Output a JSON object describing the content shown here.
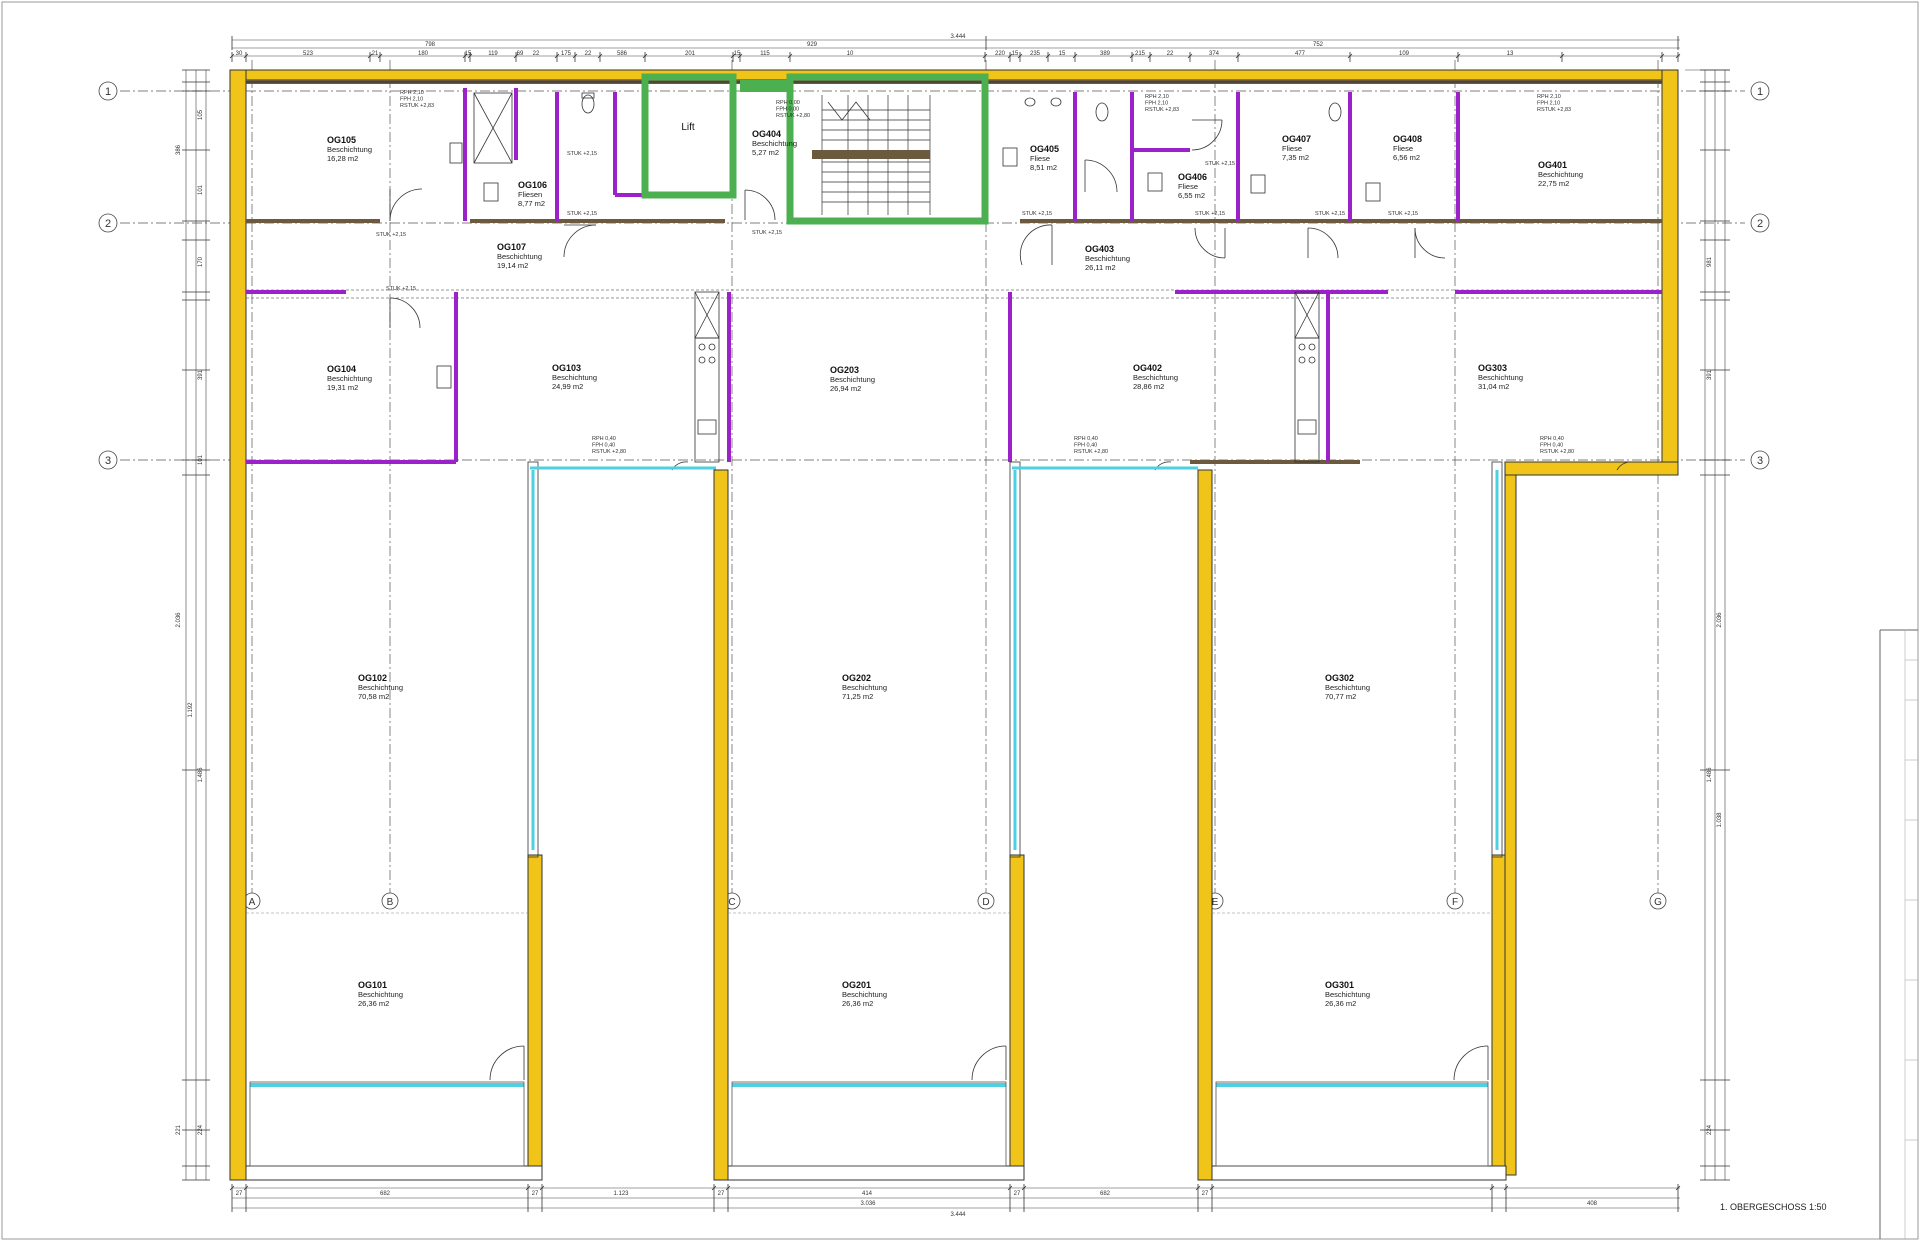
{
  "plan": {
    "title": "1. OBERGESCHOSS 1:50",
    "axes_rows": [
      "1",
      "2",
      "3"
    ],
    "axes_cols": [
      "A",
      "B",
      "C",
      "D",
      "E",
      "F",
      "G"
    ],
    "top_dims": {
      "overall": "3.444",
      "seg_a": "798",
      "seg_b": "929",
      "seg_c": "752",
      "details": [
        "30",
        "523",
        "21",
        "180",
        "15",
        "119",
        "69",
        "22",
        "175",
        "22",
        "586",
        "201",
        "15",
        "115",
        "10",
        "220",
        "15",
        "235",
        "15",
        "389",
        "215",
        "22",
        "374",
        "477",
        "109",
        "13"
      ]
    },
    "bottom_dims": {
      "overall": "3.444",
      "row1": [
        "27",
        "682",
        "27",
        "1.123",
        "27",
        "414",
        "27",
        "682",
        "27"
      ],
      "row2": [
        "3.036",
        "408"
      ]
    },
    "left_dims": [
      "386",
      "2.036",
      "1.192",
      "1.486",
      "224",
      "221",
      "105",
      "170",
      "391",
      "101",
      "101"
    ],
    "right_dims": [
      "2.036",
      "1.486",
      "1.038",
      "224",
      "981",
      "391"
    ],
    "rooms": [
      {
        "id": "OG105",
        "type": "Beschichtung",
        "area": "16,28 m2"
      },
      {
        "id": "OG106",
        "type": "Fliesen",
        "area": "8,77 m2"
      },
      {
        "id": "Lift",
        "type": "",
        "area": ""
      },
      {
        "id": "OG404",
        "type": "Beschichtung",
        "area": "5,27 m2"
      },
      {
        "id": "OG405",
        "type": "Fliese",
        "area": "8,51 m2"
      },
      {
        "id": "OG406",
        "type": "Fliese",
        "area": "6,55 m2"
      },
      {
        "id": "OG407",
        "type": "Fliese",
        "area": "7,35 m2"
      },
      {
        "id": "OG408",
        "type": "Fliese",
        "area": "6,56 m2"
      },
      {
        "id": "OG401",
        "type": "Beschichtung",
        "area": "22,75 m2"
      },
      {
        "id": "OG107",
        "type": "Beschichtung",
        "area": "19,14 m2"
      },
      {
        "id": "OG403",
        "type": "Beschichtung",
        "area": "26,11 m2"
      },
      {
        "id": "OG104",
        "type": "Beschichtung",
        "area": "19,31 m2"
      },
      {
        "id": "OG103",
        "type": "Beschichtung",
        "area": "24,99 m2"
      },
      {
        "id": "OG203",
        "type": "Beschichtung",
        "area": "26,94 m2"
      },
      {
        "id": "OG402",
        "type": "Beschichtung",
        "area": "28,86 m2"
      },
      {
        "id": "OG303",
        "type": "Beschichtung",
        "area": "31,04 m2"
      },
      {
        "id": "OG102",
        "type": "Beschichtung",
        "area": "70,58 m2"
      },
      {
        "id": "OG202",
        "type": "Beschichtung",
        "area": "71,25 m2"
      },
      {
        "id": "OG302",
        "type": "Beschichtung",
        "area": "70,77 m2"
      },
      {
        "id": "OG101",
        "type": "Beschichtung",
        "area": "26,36 m2"
      },
      {
        "id": "OG201",
        "type": "Beschichtung",
        "area": "26,36 m2"
      },
      {
        "id": "OG301",
        "type": "Beschichtung",
        "area": "26,36 m2"
      }
    ],
    "annotations": {
      "stuk": [
        "STUK +2,15",
        "STUK +2,15",
        "STUK +2,15",
        "STUK +2,15",
        "STUK +2,15",
        "STUK +2,15",
        "STUK +2,15",
        "STUK +2,15",
        "STUK +2,15",
        "STUK +2,15"
      ],
      "rph_a": [
        "RPH 2,10",
        "FPH 2,10",
        "RSTUK +2,83"
      ],
      "rph_b": [
        "RPH 0,00",
        "FPH 0,00",
        "RSTUK +2,80"
      ],
      "rph_c": [
        "RPH 2,10",
        "FPH 2,10",
        "RSTUK +2,83"
      ],
      "rph_d": [
        "RPH 2,10",
        "FPH 2,10",
        "RSTUK +2,83"
      ],
      "rph_e": [
        "RPH 0,40",
        "FPH 0,40",
        "RSTUK +2,80"
      ],
      "rph_f": [
        "RPH 0,40",
        "FPH 0,40",
        "RSTUK +2,80"
      ],
      "rph_g": [
        "RPH 0,40",
        "FPH 0,40",
        "RSTUK +2,80"
      ]
    },
    "colors": {
      "insulation": "#f0c419",
      "partition": "#9b22c9",
      "stair": "#4caf50",
      "glass": "#4dd0e1",
      "wall": "#6b5a3e"
    }
  }
}
